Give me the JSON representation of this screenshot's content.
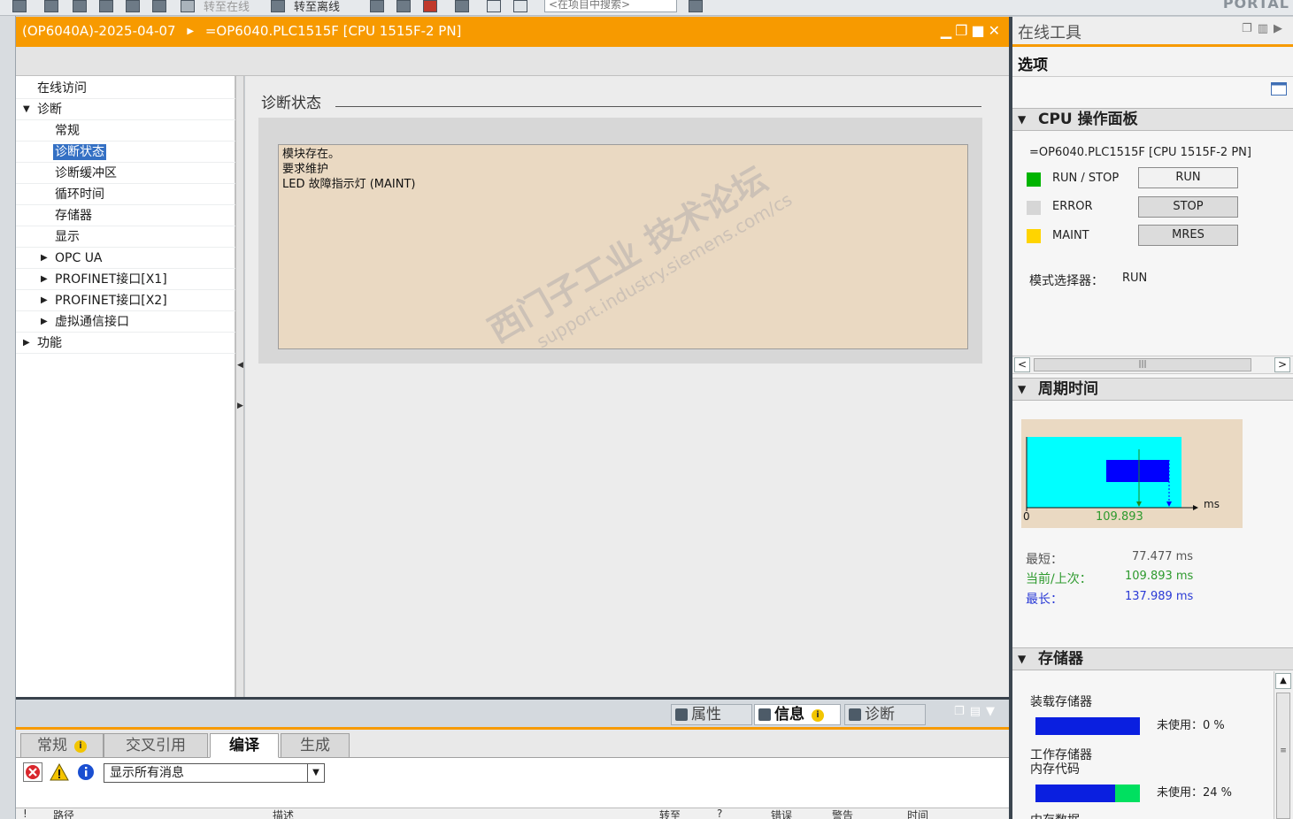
{
  "toolbar": {
    "go_online": "转至在线",
    "go_offline": "转至离线",
    "search_placeholder": "<在项目中搜索>",
    "brand": "PORTAL"
  },
  "window": {
    "breadcrumb_project": "(OP6040A)-2025-04-07",
    "breadcrumb_device": "=OP6040.PLC1515F [CPU 1515F-2 PN]"
  },
  "tree": {
    "items": [
      {
        "label": "在线访问"
      },
      {
        "label": "诊断"
      },
      {
        "label": "常规"
      },
      {
        "label": "诊断状态"
      },
      {
        "label": "诊断缓冲区"
      },
      {
        "label": "循环时间"
      },
      {
        "label": "存储器"
      },
      {
        "label": "显示"
      },
      {
        "label": "OPC UA"
      },
      {
        "label": "PROFINET接口[X1]"
      },
      {
        "label": "PROFINET接口[X2]"
      },
      {
        "label": "虚拟通信接口"
      },
      {
        "label": "功能"
      }
    ]
  },
  "content": {
    "section_title": "诊断状态",
    "status_lines": [
      "模块存在。",
      "要求维护",
      "LED 故障指示灯 (MAINT)"
    ]
  },
  "watermark": {
    "line1": "西门子工业 技术论坛",
    "line2": "support.industry.siemens.com/cs"
  },
  "inspector": {
    "tabs": [
      {
        "label": "属性"
      },
      {
        "label": "信息"
      },
      {
        "label": "诊断"
      }
    ],
    "info_badge": "i",
    "subtabs": [
      {
        "label": "常规"
      },
      {
        "label": "交叉引用"
      },
      {
        "label": "编译"
      },
      {
        "label": "生成"
      }
    ],
    "filter_value": "显示所有消息",
    "columns": [
      "!",
      "路径",
      "描述",
      "转至",
      "?",
      "错误",
      "警告",
      "时间"
    ]
  },
  "right_pane": {
    "title": "在线工具",
    "options": "选项",
    "cpu_panel": {
      "heading": "CPU 操作面板",
      "device": "=OP6040.PLC1515F [CPU 1515F-2 PN]",
      "leds": [
        {
          "label": "RUN / STOP",
          "color": "#00b400",
          "button": "RUN"
        },
        {
          "label": "ERROR",
          "color": "#d6d6d6",
          "button": "STOP"
        },
        {
          "label": "MAINT",
          "color": "#ffd400",
          "button": "MRES"
        }
      ],
      "mode_selector_label": "模式选择器：",
      "mode_selector_value": "RUN"
    },
    "cycle_time": {
      "heading": "周期时间",
      "axis_zero": "0",
      "axis_unit": "ms",
      "marker_value": "109.893",
      "rows": [
        {
          "label": "最短：",
          "value": "77.477 ms",
          "color": "#555555"
        },
        {
          "label": "当前/上次：",
          "value": "109.893 ms",
          "color": "#2e9a2e"
        },
        {
          "label": "最长：",
          "value": "137.989 ms",
          "color": "#2b3bd6"
        }
      ]
    },
    "memory": {
      "heading": "存储器",
      "load_label": "装载存储器",
      "load_unused": "未使用：0 %",
      "load_used_fraction": 1.0,
      "work_label_1": "工作存储器",
      "work_label_2": "内存代码",
      "work_unused": "未使用：24 %",
      "work_used_fraction": 0.76,
      "data_label": "内存数据"
    }
  },
  "colors": {
    "accent": "#f79a00",
    "selection": "#3470c4",
    "status_bg": "#ead9c2",
    "cycle_fill": "#00ffff",
    "cycle_bar": "#0000ff"
  }
}
